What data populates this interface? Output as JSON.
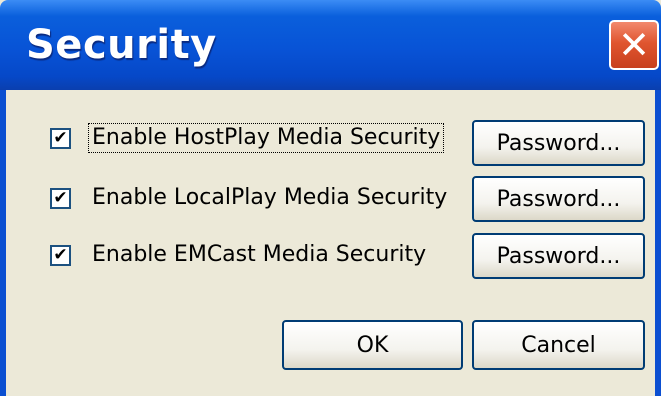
{
  "window": {
    "title": "Security",
    "close_symbol": "✕"
  },
  "options": [
    {
      "label": "Enable HostPlay Media Security",
      "checked": true,
      "checkmark": "✔",
      "button_label": "Password..."
    },
    {
      "label": "Enable LocalPlay Media Security",
      "checked": true,
      "checkmark": "✔",
      "button_label": "Password..."
    },
    {
      "label": "Enable EMCast Media Security",
      "checked": true,
      "checkmark": "✔",
      "button_label": "Password..."
    }
  ],
  "footer": {
    "ok_label": "OK",
    "cancel_label": "Cancel"
  },
  "colors": {
    "titlebar": "#0853d6",
    "dialog_background": "#ece9d8",
    "close_button": "#e0552f"
  }
}
